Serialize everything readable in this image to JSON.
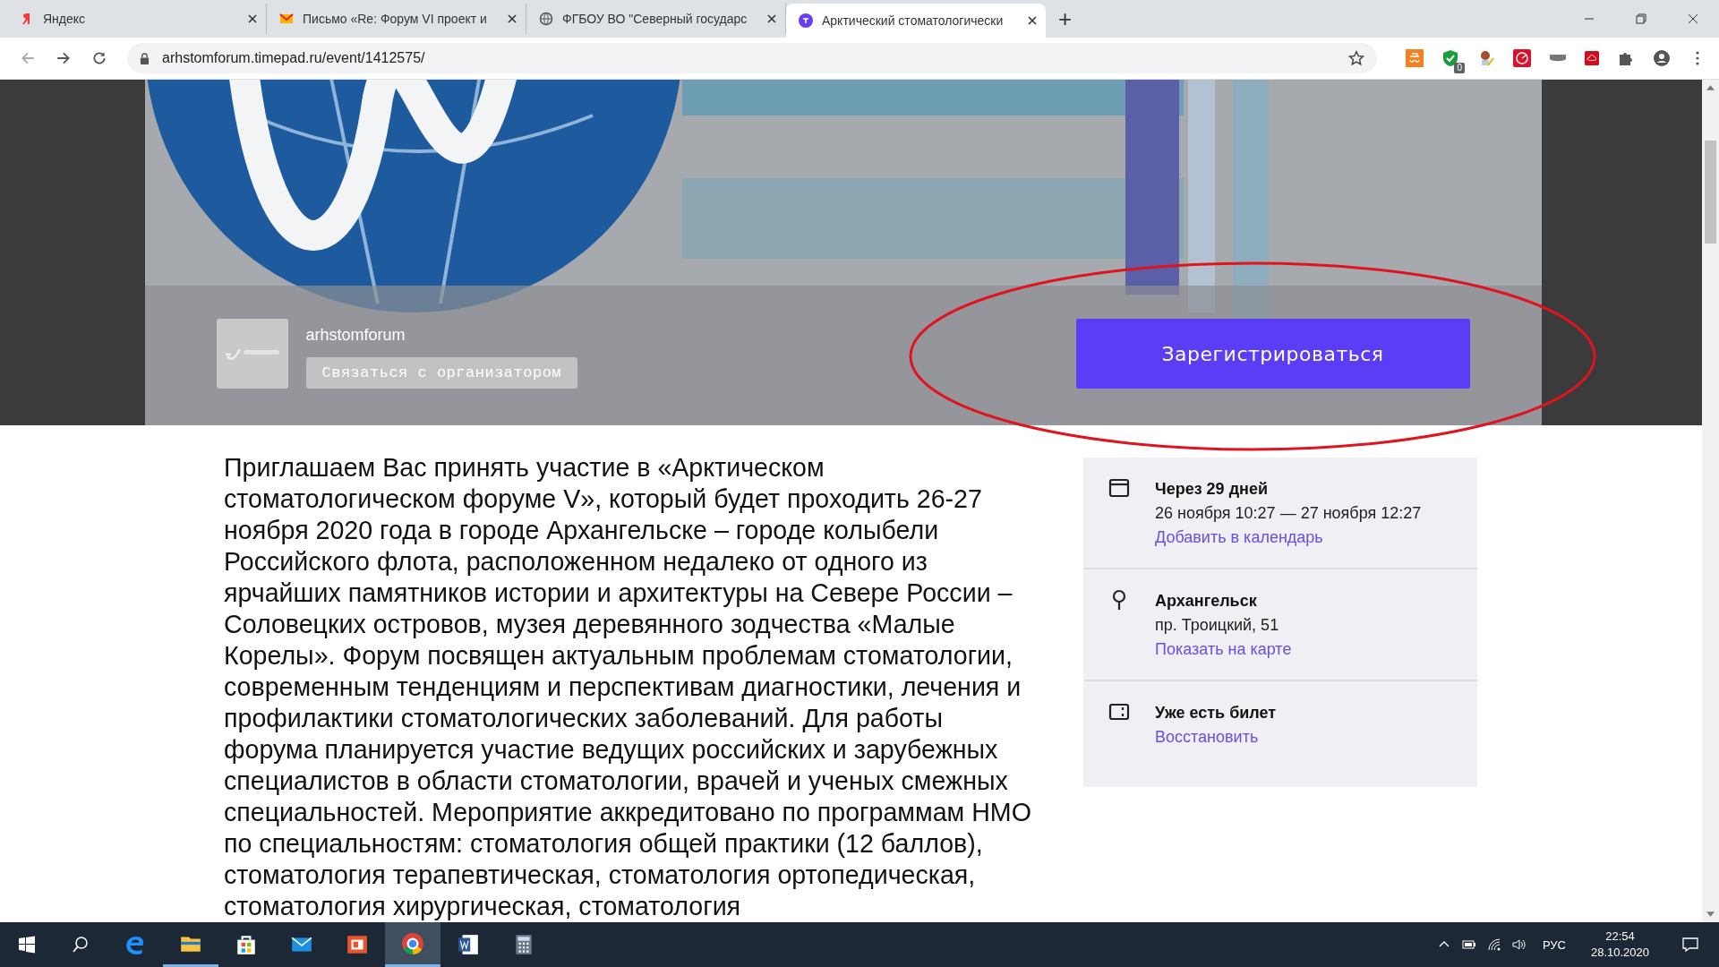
{
  "browser": {
    "tabs": [
      {
        "kind": "yandex",
        "title": "Яндекс",
        "selected": false
      },
      {
        "kind": "mail",
        "title": "Письмо «Re: Форум VI проект и",
        "selected": false
      },
      {
        "kind": "globe",
        "title": "ФГБОУ ВО \"Северный государс",
        "selected": false
      },
      {
        "kind": "timepad",
        "title": "Арктический стоматологически",
        "selected": true
      }
    ],
    "new_tab": "+",
    "url": "arhstomforum.timepad.ru/event/1412575/",
    "extension_badge": "0"
  },
  "banner": {
    "kind": "picture",
    "organizer_name": "arhstomforum",
    "contact_button": "Связаться с организатором",
    "register_button": "Зарегистрироваться"
  },
  "description": "Приглашаем Вас принять участие в «Арктическом стоматологическом форуме V», который будет проходить 26-27 ноября 2020 года в городе Архангельске – городе колыбели Российского флота, расположенном недалеко от одного из ярчайших памятников истории и архитектуры на Севере России – Соловецких островов, музея деревянного зодчества «Малые Корелы». Форум посвящен актуальным проблемам стоматологии, современным тенденциям и перспективам диагностики, лечения и профилактики стоматологических заболеваний. Для работы форума планируется участие ведущих российских и зарубежных специалистов в области стоматологии, врачей и ученых смежных специальностей. Мероприятие аккредитовано по программам НМО по специальностям: стоматология общей практики (12 баллов), стоматология терапевтическая, стоматология ортопедическая, стоматология хирургическая, стоматология",
  "event_info": [
    {
      "kind": "date",
      "title": "Через 29 дней",
      "detail": "26 ноября 10:27 — 27 ноября 12:27",
      "link": "Добавить в календарь"
    },
    {
      "kind": "place",
      "title": "Архангельск",
      "detail": "пр. Троицкий, 51",
      "link": "Показать на карте"
    },
    {
      "kind": "ticket",
      "title": "Уже есть билет",
      "link": "Восстановить"
    }
  ],
  "taskbar": {
    "apps": [
      {
        "kind": "edge",
        "running": false,
        "selected": false
      },
      {
        "kind": "explorer",
        "running": true,
        "selected": false
      },
      {
        "kind": "store",
        "running": false,
        "selected": false
      },
      {
        "kind": "mail",
        "running": false,
        "selected": false
      },
      {
        "kind": "office",
        "running": false,
        "selected": false
      },
      {
        "kind": "chrome",
        "running": true,
        "selected": true
      },
      {
        "kind": "word",
        "running": false,
        "selected": false
      },
      {
        "kind": "calculator",
        "running": false,
        "selected": false
      }
    ],
    "language": "РУС",
    "time": "22:54",
    "date": "28.10.2020"
  }
}
